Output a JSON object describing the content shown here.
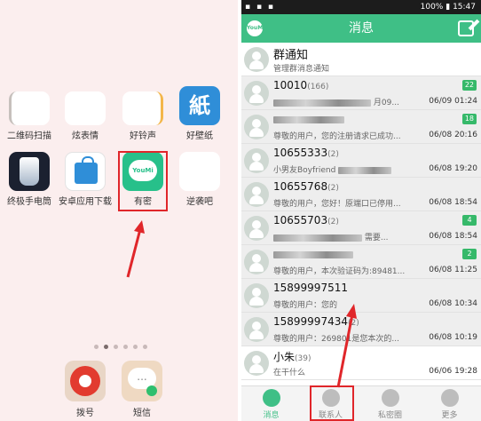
{
  "home": {
    "row1": [
      {
        "label": "二维码扫描",
        "icon": "qr-scan-icon"
      },
      {
        "label": "炫表情",
        "icon": "emoji-icon"
      },
      {
        "label": "好铃声",
        "icon": "ringtone-icon"
      },
      {
        "label": "好壁纸",
        "icon": "wallpaper-icon",
        "glyph": "紙"
      }
    ],
    "row2": [
      {
        "label": "终极手电筒",
        "icon": "flashlight-icon"
      },
      {
        "label": "安卓应用下载",
        "icon": "app-store-icon"
      },
      {
        "label": "有密",
        "icon": "youmi-icon",
        "glyph": "YouMi"
      },
      {
        "label": "逆袭吧",
        "icon": "nixi-icon"
      }
    ],
    "page_dots": 6,
    "active_dot": 1,
    "dock": [
      {
        "label": "拨号",
        "icon": "dialer-icon"
      },
      {
        "label": "短信",
        "icon": "sms-icon",
        "glyph": "..."
      }
    ]
  },
  "status_bar": {
    "battery": "100%",
    "time": "15:47"
  },
  "messages": {
    "title": "消息",
    "logo_text": "YouMi",
    "items": [
      {
        "name": "群通知",
        "count": "",
        "sub": "管理群消息通知",
        "time": "",
        "badge": ""
      },
      {
        "name": "10010",
        "count": "(166)",
        "sub": "月09...",
        "time": "06/09 01:24",
        "badge": "22"
      },
      {
        "name": "",
        "count": "",
        "sub": "尊敬的用户，您的注册请求已成功...",
        "time": "06/08 20:16",
        "badge": "18"
      },
      {
        "name": "10655333",
        "count": "(2)",
        "sub": "小男友Boyfriend",
        "time": "06/08 19:20",
        "badge": ""
      },
      {
        "name": "10655768",
        "count": "(2)",
        "sub": "尊敬的用户，您好！原端口已停用...",
        "time": "06/08 18:54",
        "badge": ""
      },
      {
        "name": "10655703",
        "count": "(2)",
        "sub": "需要...",
        "time": "06/08 18:54",
        "badge": "4"
      },
      {
        "name": "",
        "count": "",
        "sub": "尊敬的用户，本次验证码为:89481...",
        "time": "06/08 11:25",
        "badge": "2"
      },
      {
        "name": "15899997511",
        "count": "",
        "sub": "尊敬的用户：您的",
        "time": "06/08 10:34",
        "badge": ""
      },
      {
        "name": "15899997434",
        "count": "(2)",
        "sub": "尊敬的用户：269801是您本次的...",
        "time": "06/08 10:19",
        "badge": ""
      },
      {
        "name": "小朱",
        "count": "(39)",
        "sub": "在干什么",
        "time": "06/06 19:28",
        "badge": ""
      }
    ],
    "tabs": [
      {
        "label": "消息",
        "active": true
      },
      {
        "label": "联系人",
        "active": false
      },
      {
        "label": "私密圈",
        "active": false
      },
      {
        "label": "更多",
        "active": false
      }
    ]
  },
  "colors": {
    "accent": "#3fbf86",
    "highlight_box": "#e0262a",
    "badge": "#36b96a"
  }
}
